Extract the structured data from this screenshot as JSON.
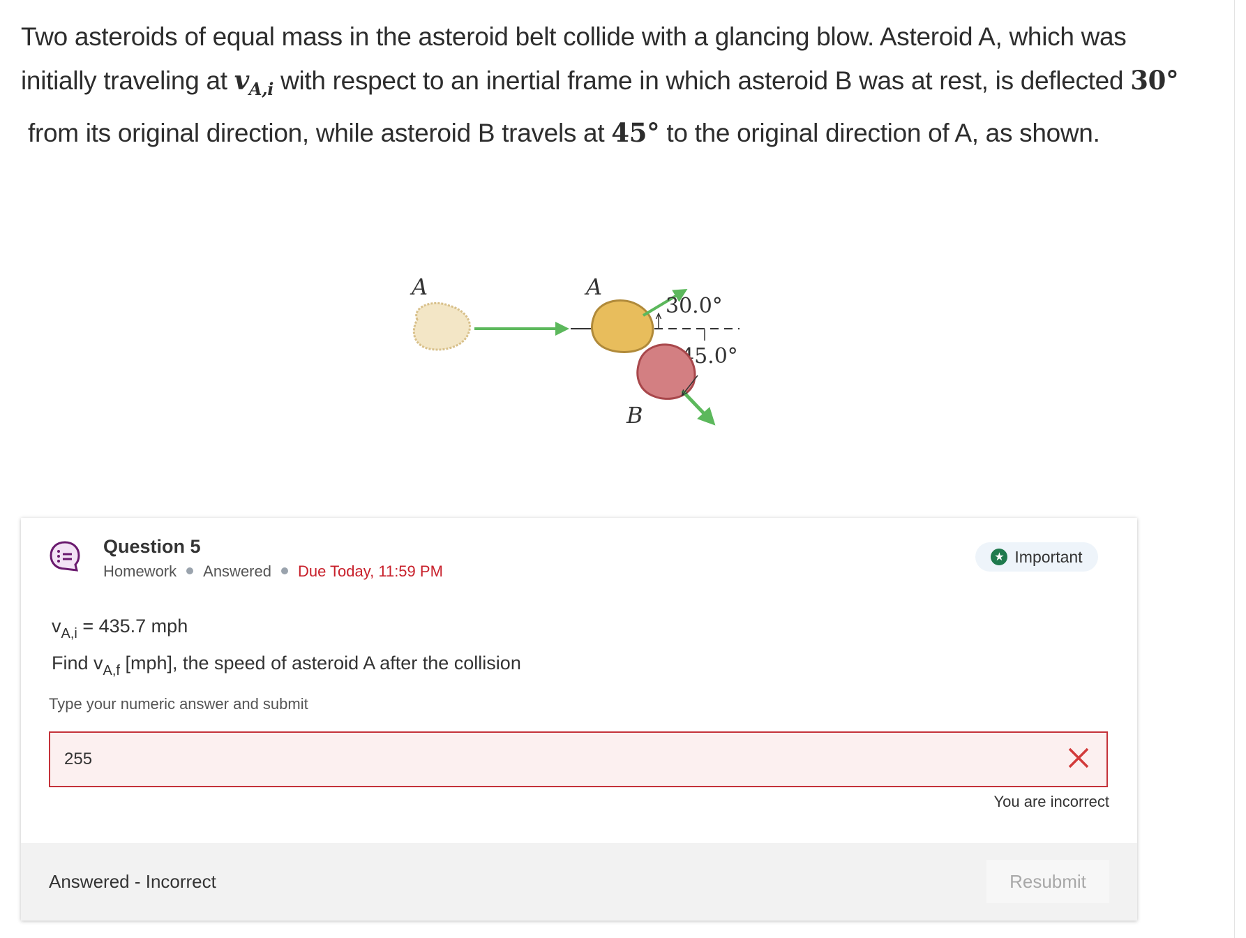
{
  "problem": {
    "line1": "Two asteroids of equal mass in the asteroid belt collide with a glancing blow. Asteroid A, which was",
    "line2_pre": "initially traveling at ",
    "line2_var": "v",
    "line2_sub": "A,i",
    "line2_post": " with respect to an inertial frame in which asteroid B was at rest, is deflected ",
    "line2_angle": "30°",
    "line3_pre": "from its original direction, while asteroid B travels at ",
    "line3_angle": "45°",
    "line3_post": " to the original direction of A, as shown."
  },
  "figure": {
    "label_a_initial": "A",
    "label_a_after": "A",
    "label_b": "B",
    "angle_a": "30.0°",
    "angle_b": "45.0°",
    "arrow_color": "#5cb85c",
    "asteroid_a_color": "#d8b060",
    "asteroid_b_color": "#c85a5a"
  },
  "question": {
    "title": "Question 5",
    "category": "Homework",
    "status": "Answered",
    "due": "Due Today, 11:59 PM",
    "badge": "Important",
    "given_var": "v",
    "given_sub": "A,i",
    "given_value": " = 435.7 mph",
    "find_pre": "Find v",
    "find_sub": "A,f",
    "find_post": " [mph], the speed of asteroid A after the collision",
    "hint": "Type your numeric answer and submit",
    "answer_value": "255",
    "feedback": "You are incorrect",
    "footer_status": "Answered - Incorrect",
    "resubmit_label": "Resubmit"
  }
}
